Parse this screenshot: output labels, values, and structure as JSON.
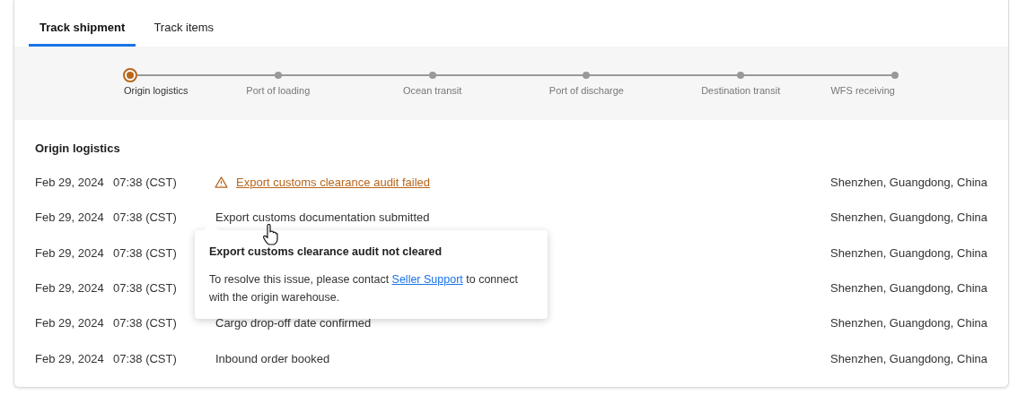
{
  "tabs": [
    {
      "label": "Track shipment",
      "selected": true
    },
    {
      "label": "Track items",
      "selected": false
    }
  ],
  "steps": [
    {
      "label": "Origin logistics",
      "selected": true
    },
    {
      "label": "Port of loading",
      "selected": false
    },
    {
      "label": "Ocean transit",
      "selected": false
    },
    {
      "label": "Port of discharge",
      "selected": false
    },
    {
      "label": "Destination transit",
      "selected": false
    },
    {
      "label": "WFS receiving",
      "selected": false
    }
  ],
  "section_title": "Origin logistics",
  "events": [
    {
      "date": "Feb 29, 2024",
      "time": "07:38 (CST)",
      "activity": "Export customs clearance audit failed",
      "kind": "alert",
      "location": "Shenzhen, Guangdong, China"
    },
    {
      "date": "Feb 29, 2024",
      "time": "07:38 (CST)",
      "activity": "Export customs documentation submitted",
      "kind": "normal",
      "location": "Shenzhen, Guangdong, China"
    },
    {
      "date": "Feb 29, 2024",
      "time": "07:38 (CST)",
      "kind": "normal",
      "location": "Shenzhen, Guangdong, China"
    },
    {
      "date": "Feb 29, 2024",
      "time": "07:38 (CST)",
      "kind": "normal",
      "location": "Shenzhen, Guangdong, China"
    },
    {
      "date": "Feb 29, 2024",
      "time": "07:38 (CST)",
      "activity": "Cargo drop-off date confirmed",
      "kind": "normal",
      "location": "Shenzhen, Guangdong, China"
    },
    {
      "date": "Feb 29, 2024",
      "time": "07:38 (CST)",
      "activity": "Inbound order booked",
      "kind": "normal",
      "location": "Shenzhen, Guangdong, China"
    }
  ],
  "tooltip": {
    "title": "Export customs clearance audit not cleared",
    "text_before": "To resolve this issue, please contact",
    "link": "Seller Support",
    "text_after": "to connect with the origin warehouse."
  }
}
